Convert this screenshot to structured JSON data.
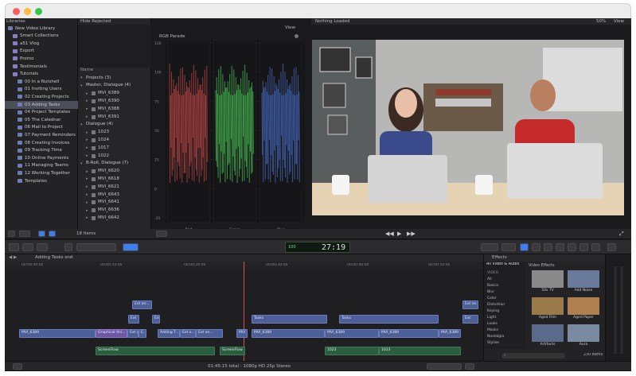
{
  "window": {
    "title": ""
  },
  "libraries": {
    "header": "Libraries",
    "items": [
      {
        "label": "New Video Library",
        "level": 0,
        "selected": false
      },
      {
        "label": "Smart Collections",
        "level": 1,
        "selected": false
      },
      {
        "label": "a51 Vlog",
        "level": 1,
        "selected": false
      },
      {
        "label": "Export",
        "level": 1,
        "selected": false
      },
      {
        "label": "Promo",
        "level": 1,
        "selected": false
      },
      {
        "label": "Testimonials",
        "level": 1,
        "selected": false
      },
      {
        "label": "Tutorials",
        "level": 1,
        "selected": false
      },
      {
        "label": "00 In a Nutshell",
        "level": 2,
        "selected": false
      },
      {
        "label": "01 Inviting Users",
        "level": 2,
        "selected": false
      },
      {
        "label": "02 Creating Projects",
        "level": 2,
        "selected": false
      },
      {
        "label": "03 Adding Tasks",
        "level": 2,
        "selected": true
      },
      {
        "label": "04 Project Templates",
        "level": 2,
        "selected": false
      },
      {
        "label": "05 The Calednar",
        "level": 2,
        "selected": false
      },
      {
        "label": "06 Mail to Project",
        "level": 2,
        "selected": false
      },
      {
        "label": "07 Payment Reminders",
        "level": 2,
        "selected": false
      },
      {
        "label": "08 Creating Invoices",
        "level": 2,
        "selected": false
      },
      {
        "label": "09 Tracking Time",
        "level": 2,
        "selected": false
      },
      {
        "label": "10 Online Payments",
        "level": 2,
        "selected": false
      },
      {
        "label": "11 Managing Teams",
        "level": 2,
        "selected": false
      },
      {
        "label": "12 Working Together",
        "level": 2,
        "selected": false
      },
      {
        "label": "Templates",
        "level": 2,
        "selected": false
      }
    ]
  },
  "browser": {
    "filter": "Hide Rejected",
    "name_header": "Name",
    "item_count": "18 Items",
    "rows": [
      {
        "label": "Projects",
        "count": "(3)",
        "level": 0
      },
      {
        "label": "Master, Dialogue",
        "count": "(4)",
        "level": 0
      },
      {
        "label": "MVI_6389",
        "count": "",
        "level": 1
      },
      {
        "label": "MVI_6390",
        "count": "",
        "level": 1
      },
      {
        "label": "MVI_6388",
        "count": "",
        "level": 1
      },
      {
        "label": "MVI_6391",
        "count": "",
        "level": 1
      },
      {
        "label": "Dialogue",
        "count": "(4)",
        "level": 0
      },
      {
        "label": "1023",
        "count": "",
        "level": 1
      },
      {
        "label": "1024",
        "count": "",
        "level": 1
      },
      {
        "label": "1017",
        "count": "",
        "level": 1
      },
      {
        "label": "1022",
        "count": "",
        "level": 1
      },
      {
        "label": "B-Roll, Dialogue",
        "count": "(7)",
        "level": 0
      },
      {
        "label": "MVI_6620",
        "count": "",
        "level": 1
      },
      {
        "label": "MVI_6618",
        "count": "",
        "level": 1
      },
      {
        "label": "MVI_6621",
        "count": "",
        "level": 1
      },
      {
        "label": "MVI_6643",
        "count": "",
        "level": 1
      },
      {
        "label": "MVI_6641",
        "count": "",
        "level": 1
      },
      {
        "label": "MVI_6636",
        "count": "",
        "level": 1
      },
      {
        "label": "MVI_6642",
        "count": "",
        "level": 1
      }
    ]
  },
  "scopes": {
    "title": "RGB Parade",
    "view_label": "View",
    "y_ticks": [
      "120",
      "100",
      "75",
      "50",
      "25",
      "0",
      "-20"
    ],
    "channels": [
      "Red",
      "Green",
      "Blue"
    ],
    "colors": {
      "red": "#ff5a5a",
      "green": "#5aff6a",
      "blue": "#5a8aff"
    }
  },
  "viewer": {
    "status": "Nothing Loaded",
    "zoom": "50%",
    "view_label": "View"
  },
  "toolbar": {
    "timecode": "27:19",
    "timecode_prefix": "100"
  },
  "timeline": {
    "project_name": "Adding Tasks snd",
    "ruler": [
      "00:00:00:00",
      "00:00:10:00",
      "00:00:20:00",
      "00:00:30:00",
      "00:00:40:00",
      "00:00:50:00"
    ],
    "clips_top": [
      "Ext on...",
      "Ext",
      "Ext",
      "Ext on...",
      "Ext"
    ],
    "primary_clips": [
      "MVI_6389",
      "Graphical Ani...",
      "Ext on...",
      "E...",
      "Adding T...",
      "Ext o...",
      "Ext on...",
      "MVI",
      "MVI_6389",
      "MVI_6389",
      "MVI_6389",
      "MVI_6389"
    ],
    "secondary_top": [
      "Tasks",
      "Tasks",
      "Tasks"
    ],
    "audio_clips": [
      "ScreenFlow",
      "ScreenFlow",
      "1023",
      "1023",
      "1022",
      "1017"
    ],
    "status": "01:45:15 total - 1080p HD 25p Stereo"
  },
  "effects": {
    "header": "Effects",
    "tab_all": "All Video & Audio",
    "section_title": "Video Effects",
    "categories_heading": "VIDEO",
    "categories": [
      "All",
      "Basics",
      "Blur",
      "Color",
      "Distortion",
      "Keying",
      "Light",
      "Looks",
      "Masks",
      "Nostalgia",
      "Stylize"
    ],
    "items": [
      {
        "label": "50s TV",
        "color": "#8a8a8a"
      },
      {
        "label": "Add Noise",
        "color": "#6a7a9a"
      },
      {
        "label": "Aged Film",
        "color": "#9a7a4a"
      },
      {
        "label": "Aged Paper",
        "color": "#b08050"
      },
      {
        "label": "Artifacts",
        "color": "#5a6a8a"
      },
      {
        "label": "Aura",
        "color": "#7a8aa0"
      }
    ],
    "count": "230 Items",
    "search_placeholder": ""
  },
  "colors": {
    "accent": "#3b7ff5",
    "selection": "#4a4f5a",
    "clip_blue": "#4c5f98",
    "clip_purple": "#6d58a8",
    "clip_green": "#2a5e3e"
  }
}
